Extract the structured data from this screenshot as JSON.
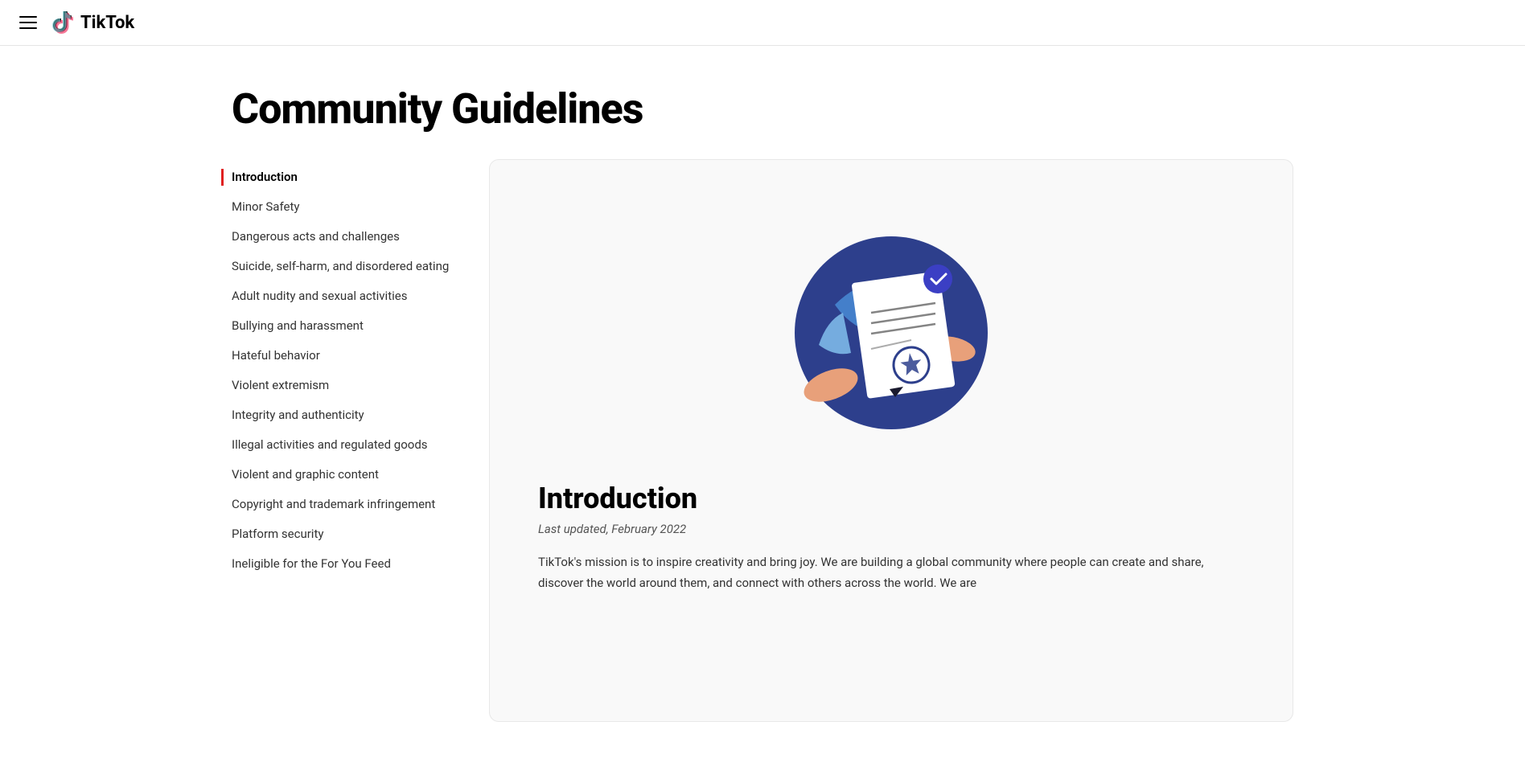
{
  "header": {
    "hamburger_label": "Menu",
    "logo_text": "TikTok"
  },
  "page": {
    "title": "Community Guidelines"
  },
  "sidebar": {
    "items": [
      {
        "id": "introduction",
        "label": "Introduction",
        "active": true
      },
      {
        "id": "minor-safety",
        "label": "Minor Safety",
        "active": false
      },
      {
        "id": "dangerous-acts",
        "label": "Dangerous acts and challenges",
        "active": false
      },
      {
        "id": "suicide",
        "label": "Suicide, self-harm, and disordered eating",
        "active": false
      },
      {
        "id": "adult-nudity",
        "label": "Adult nudity and sexual activities",
        "active": false
      },
      {
        "id": "bullying",
        "label": "Bullying and harassment",
        "active": false
      },
      {
        "id": "hateful",
        "label": "Hateful behavior",
        "active": false
      },
      {
        "id": "violent-extremism",
        "label": "Violent extremism",
        "active": false
      },
      {
        "id": "integrity",
        "label": "Integrity and authenticity",
        "active": false
      },
      {
        "id": "illegal-activities",
        "label": "Illegal activities and regulated goods",
        "active": false
      },
      {
        "id": "violent-graphic",
        "label": "Violent and graphic content",
        "active": false
      },
      {
        "id": "copyright",
        "label": "Copyright and trademark infringement",
        "active": false
      },
      {
        "id": "platform-security",
        "label": "Platform security",
        "active": false
      },
      {
        "id": "ineligible",
        "label": "Ineligible for the For You Feed",
        "active": false
      }
    ]
  },
  "intro_section": {
    "heading": "Introduction",
    "last_updated": "Last updated, February 2022",
    "body_text": "TikTok's mission is to inspire creativity and bring joy. We are building a global community where people can create and share, discover the world around them, and connect with others across the world. We are"
  },
  "colors": {
    "active_border": "#e02020",
    "circle_bg": "#2d3f8c",
    "circle_accent1": "#4a90d9",
    "circle_accent2": "#7db8e8",
    "checkmark_circle": "#3b3fc4",
    "star_circle": "#2d3f8c",
    "skin_tone": "#e8a07a"
  }
}
